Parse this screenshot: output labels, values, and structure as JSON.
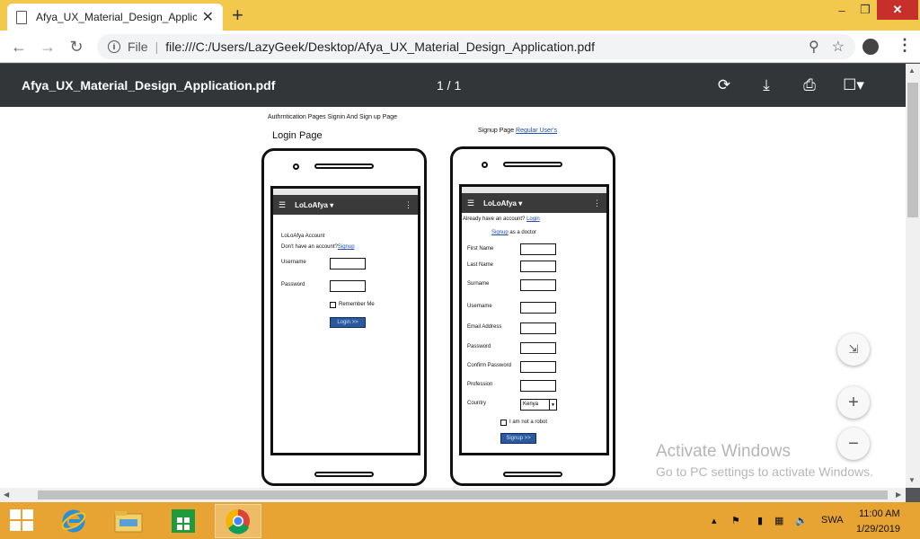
{
  "browser": {
    "tab_title": "Afya_UX_Material_Design_Applic",
    "tab_close": "✕",
    "new_tab": "+",
    "window_controls": {
      "minimize": "–",
      "maximize": "❐",
      "close": "✕"
    },
    "file_label": "File",
    "url": "file:///C:/Users/LazyGeek/Desktop/Afya_UX_Material_Design_Application.pdf"
  },
  "pdf_toolbar": {
    "title": "Afya_UX_Material_Design_Application.pdf",
    "pages": "1 / 1"
  },
  "document": {
    "caption": "Authrntication Pages Signin And Sign up Page",
    "login_heading": "Login Page",
    "signup_heading_prefix": "Signup Page",
    "signup_heading_link": "Regular User's",
    "app_title": "LoLoAfya",
    "login": {
      "account_label": "LoLoAfya Account",
      "no_account_text": "Don't have an account?",
      "signup_link": "Signup",
      "username_label": "Username",
      "password_label": "Password",
      "remember_label": "Remember Me",
      "login_button": "Login >>"
    },
    "signup": {
      "have_account_text": "Already have an account?",
      "login_link": "Login",
      "signup_doctor_link": "Signup",
      "signup_doctor_suffix": "as a doctor",
      "fields": [
        "First Name",
        "Last Name",
        "Surname",
        "Username",
        "Email Address",
        "Password",
        "Confirm Password",
        "Profession",
        "Country"
      ],
      "country_value": "Kenya",
      "robot_label": "I am not a robot",
      "signup_button": "Signup >>"
    }
  },
  "overlay": {
    "watermark_title": "Activate Windows",
    "watermark_sub": "Go to PC settings to activate Windows."
  },
  "taskbar": {
    "language": "SWA",
    "time": "11:00 AM",
    "date": "1/29/2019"
  }
}
